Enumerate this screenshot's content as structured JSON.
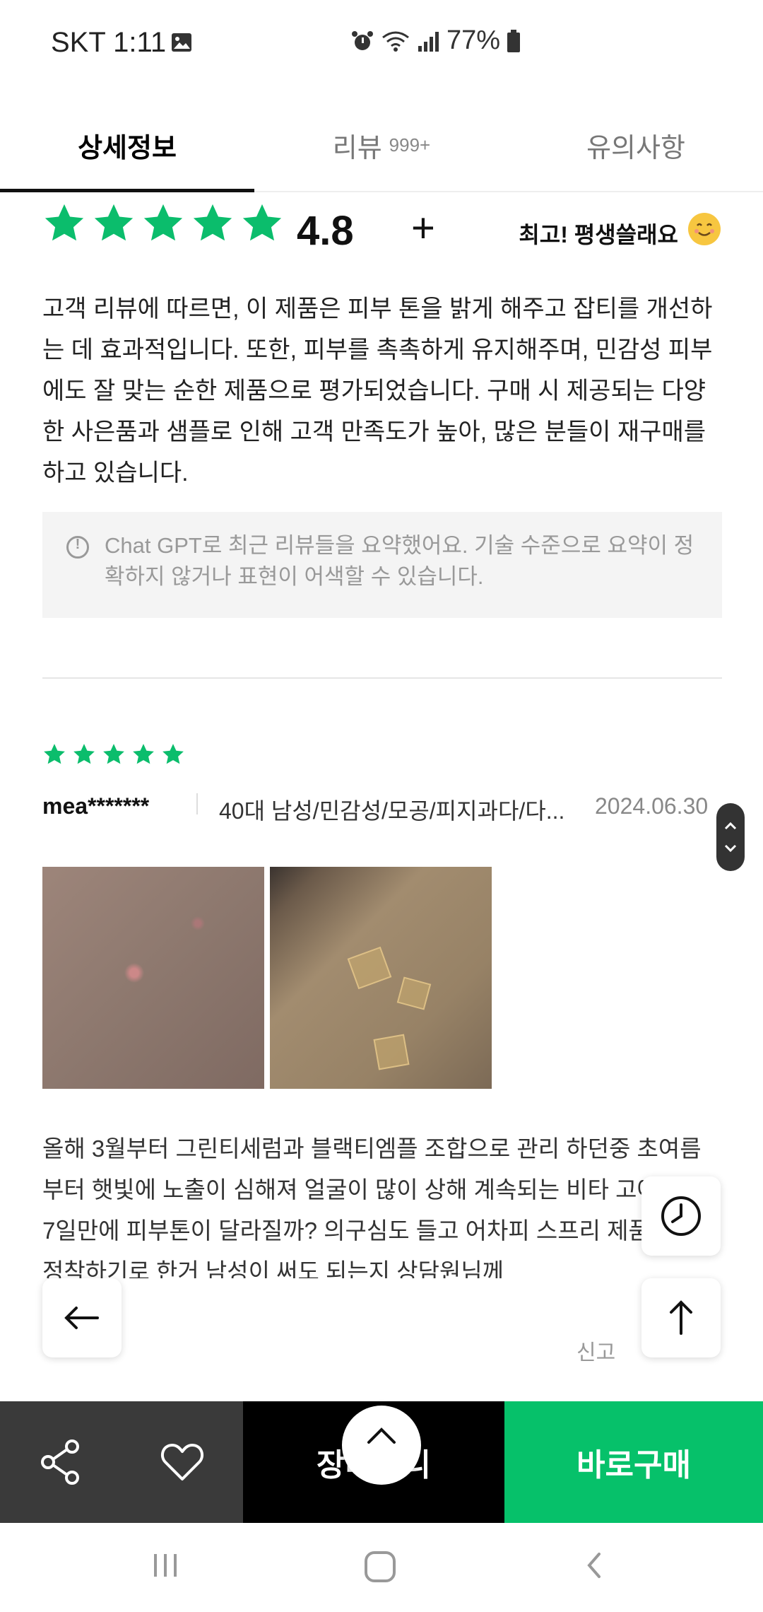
{
  "status_bar": {
    "carrier_time": "SKT 1:11",
    "battery": "77%"
  },
  "tabs": [
    {
      "label": "상세정보",
      "count": ""
    },
    {
      "label": "리뷰",
      "count": "999+"
    },
    {
      "label": "유의사항",
      "count": ""
    }
  ],
  "rating": {
    "value": "4.8",
    "plus": "+",
    "phrase": "최고! 평생쓸래요",
    "stars": 5
  },
  "summary": {
    "text": "고객 리뷰에 따르면, 이 제품은 피부 톤을 밝게 해주고 잡티를 개선하는 데 효과적입니다. 또한, 피부를 촉촉하게 유지해주며, 민감성 피부에도 잘 맞는 순한 제품으로 평가되었습니다. 구매 시 제공되는 다양한 사은품과 샘플로 인해 고객 만족도가 높아, 많은 분들이 재구매를 하고 있습니다.",
    "notice": "Chat GPT로 최근 리뷰들을 요약했어요. 기술 수준으로 요약이 정확하지 않거나 표현이 어색할 수 있습니다."
  },
  "review": {
    "stars": 5,
    "reviewer": "mea*******",
    "profile": "40대 남성/민감성/모공/피지과다/다...",
    "date": "2024.06.30",
    "text": "올해 3월부터 그린티세럼과 블랙티엠플 조합으로 관리 하던중 초여름부터 햇빛에 노출이 심해져 얼굴이 많이 상해 계속되는 비타 고에 정말 7일만에 피부톤이 달라질까? 의구심도 들고 어차피 스프리 제품으로 정착하기로 한거 남성이 써도 되는지 상담원님께",
    "report_label": "신고"
  },
  "bottom_bar": {
    "cart_label": "장바구니",
    "buy_label": "바로구매"
  },
  "colors": {
    "accent_green": "#06c16a",
    "star_green": "#0bbd6c"
  }
}
